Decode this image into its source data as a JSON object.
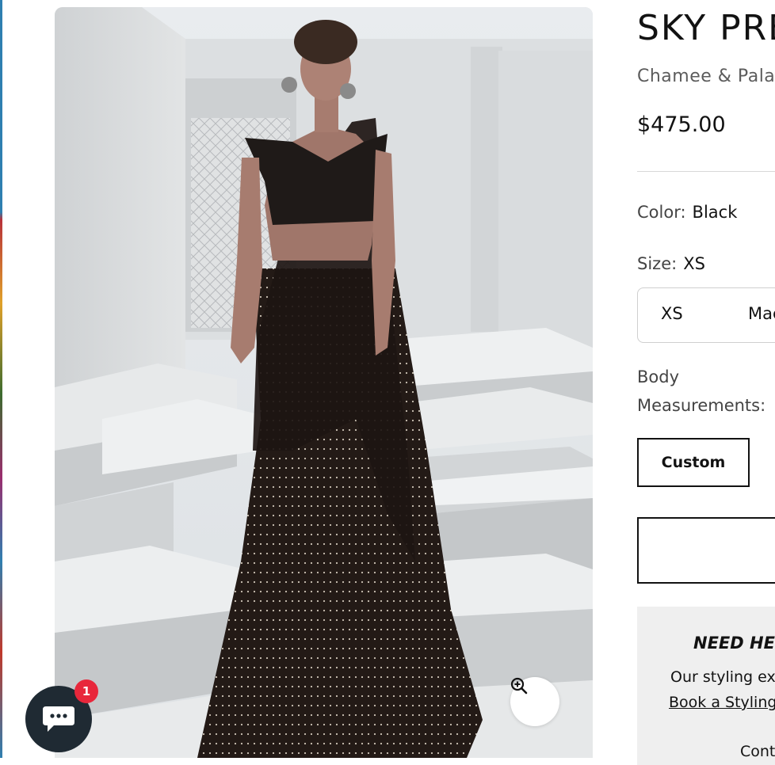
{
  "product": {
    "title": "SKY PRE",
    "vendor": "Chamee & Palak",
    "price": "$475.00"
  },
  "options": {
    "color_label": "Color:",
    "color_value": "Black",
    "size_label": "Size:",
    "size_value": "XS",
    "size_choices": [
      "XS",
      "Mac"
    ],
    "body_label_line1": "Body",
    "body_label_line2": "Measurements:",
    "custom_button": "Custom"
  },
  "help": {
    "title": "NEED HEL",
    "text": "Our styling ex",
    "link": "Book a Styling",
    "more": "Cont"
  },
  "chat": {
    "badge_count": "1",
    "icon": "chat-bubble-icon"
  },
  "media": {
    "zoom_icon": "zoom-in-icon"
  },
  "colors": {
    "chat_bg": "#1f2a33",
    "badge_bg": "#e8273b"
  }
}
